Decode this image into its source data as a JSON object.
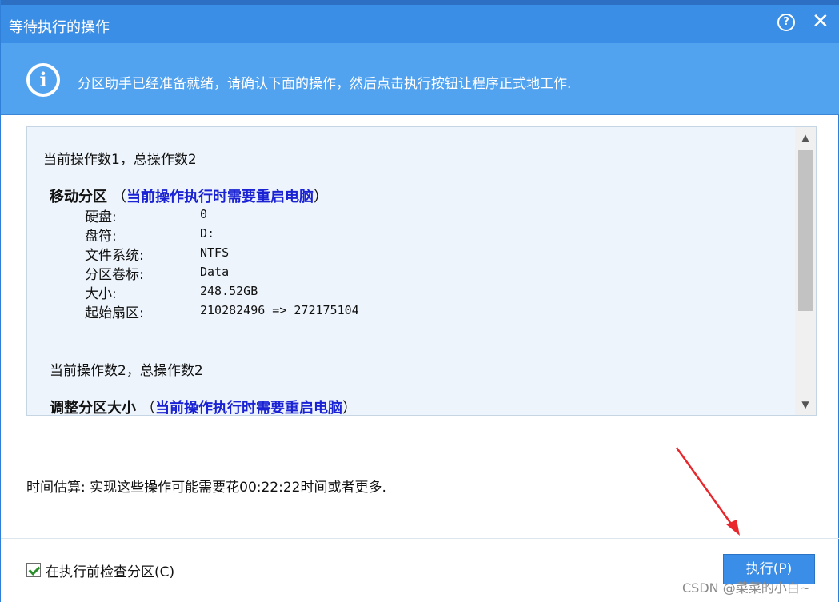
{
  "window": {
    "title": "等待执行的操作",
    "help_label": "?",
    "close_label": "✕"
  },
  "banner": {
    "icon": "info-icon",
    "icon_glyph": "i",
    "message": "分区助手已经准备就绪，请确认下面的操作，然后点击执行按钮让程序正式地工作."
  },
  "operations": {
    "op1": {
      "count_text": "当前操作数1，总操作数2",
      "title": "移动分区",
      "note_open": "（",
      "note": "当前操作执行时需要重启电脑",
      "note_close": "）",
      "fields": [
        {
          "key": "硬盘:",
          "value": "0"
        },
        {
          "key": "盘符:",
          "value": "D:"
        },
        {
          "key": "文件系统:",
          "value": "NTFS"
        },
        {
          "key": "分区卷标:",
          "value": "Data"
        },
        {
          "key": "大小:",
          "value": "248.52GB"
        },
        {
          "key": "起始扇区:",
          "value": "210282496 => 272175104"
        }
      ]
    },
    "op2": {
      "count_text": "当前操作数2，总操作数2",
      "title": "调整分区大小",
      "note_open": "（",
      "note": "当前操作执行时需要重启电脑",
      "note_close": "）"
    },
    "scroll_up": "▲",
    "scroll_down": "▼"
  },
  "estimate": "时间估算: 实现这些操作可能需要花00:22:22时间或者更多.",
  "footer": {
    "checkbox_label": "在执行前检查分区(C)",
    "checkbox_checked": true,
    "execute_label": "执行(P)"
  },
  "watermark": "CSDN @菜菜的小白~",
  "colors": {
    "title_bar": "#3a8ee6",
    "banner": "#51a2ef",
    "note_text": "#1a22d4",
    "annotation_arrow": "#e8262b"
  }
}
